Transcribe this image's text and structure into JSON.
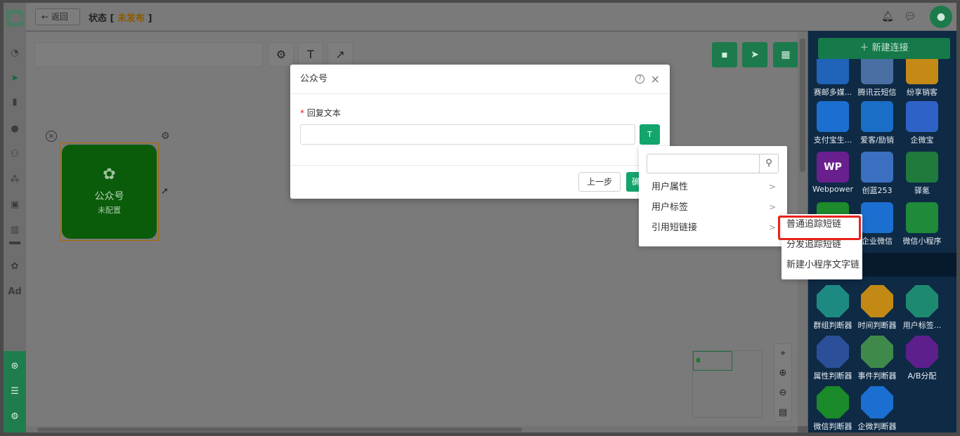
{
  "header": {
    "back_label": "返回",
    "status_prefix": "状态 [",
    "status_value": "未发布",
    "status_suffix": "]"
  },
  "toolbar": {
    "settings_icon": "gear-icon",
    "text_label": "T",
    "arrow_icon": "arrow-icon"
  },
  "node": {
    "title": "公众号",
    "subtitle": "未配置"
  },
  "right_panel": {
    "new_connection_label": "新建连接",
    "row1": [
      "赛邮多媒...",
      "腾讯云短信",
      "纷享销客"
    ],
    "row2": [
      "支付宝生...",
      "爱客/励销",
      "企微宝"
    ],
    "row3": [
      "Webpower",
      "创蓝253",
      "驿氪"
    ],
    "row4": [
      "",
      "企业微信",
      "微信小程序"
    ],
    "row5": [
      "群组判断器",
      "时间判断器",
      "用户标签..."
    ],
    "row6": [
      "属性判断器",
      "事件判断器",
      "A/B分配"
    ],
    "row7": [
      "微信判断器",
      "企微判断器"
    ],
    "tile_wp_text": "WP"
  },
  "modal": {
    "title": "公众号",
    "field_label": "回复文本",
    "required_mark": "*",
    "text_input_value": "",
    "insert_button_label": "T",
    "prev_label": "上一步",
    "ok_label": "确"
  },
  "dropdown": {
    "search_placeholder": "",
    "items": [
      "用户属性",
      "用户标签",
      "引用短链接"
    ]
  },
  "submenu": {
    "items": [
      "普通追踪短链",
      "分发追踪短链",
      "新建小程序文字链"
    ]
  },
  "colors": {
    "accent_green": "#13a56c",
    "highlight_red": "#e8231b",
    "draft_orange": "#f5a200"
  }
}
